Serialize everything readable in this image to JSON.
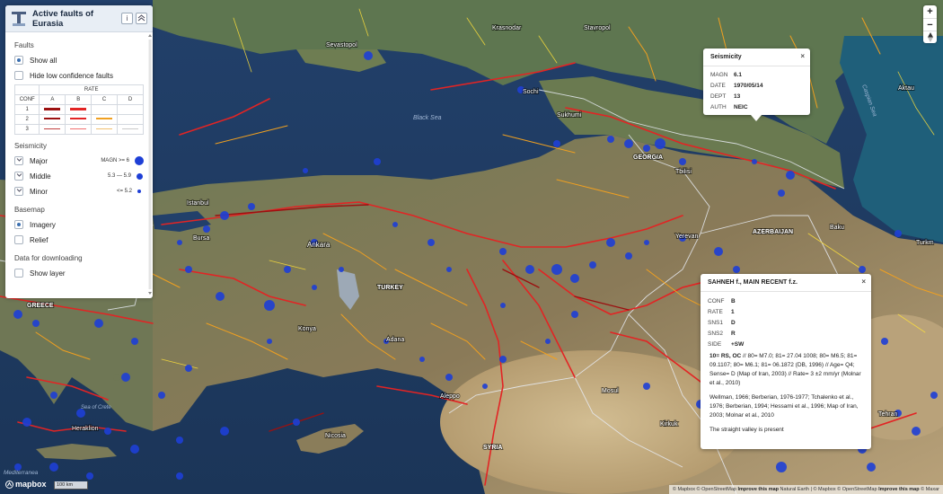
{
  "panel": {
    "title": "Active faults of Eurasia",
    "info_label": "i",
    "collapse_label": "^",
    "faults_heading": "Faults",
    "show_all": "Show all",
    "hide_low": "Hide low confidence faults",
    "rate_header": "RATE",
    "conf_header": "CONF",
    "rate_cols": [
      "A",
      "B",
      "C",
      "D"
    ],
    "conf_rows": [
      "1",
      "2",
      "3"
    ],
    "seismicity_heading": "Seismicity",
    "major": "Major",
    "major_range": "MAGN >= 6",
    "middle": "Middle",
    "middle_range": "5.3 — 5.9",
    "minor": "Minor",
    "minor_range": "<= 5.2",
    "basemap_heading": "Basemap",
    "imagery": "Imagery",
    "relief": "Relief",
    "download_heading": "Data for downloading",
    "show_layer": "Show layer"
  },
  "colors": {
    "dark_red": "#9b1010",
    "red": "#e22424",
    "orange": "#f0a020",
    "light": "#c8c8c8",
    "quake": "#1e3fd6"
  },
  "seismicity_popup": {
    "title": "Seismicity",
    "close": "×",
    "rows": [
      {
        "key": "MAGN",
        "val": "6.1"
      },
      {
        "key": "DATE",
        "val": "1970/05/14"
      },
      {
        "key": "DEPT",
        "val": "13"
      },
      {
        "key": "AUTH",
        "val": "NEIC"
      }
    ]
  },
  "fault_popup": {
    "title": "SAHNEH f., MAIN RECENT f.z.",
    "close": "×",
    "rows": [
      {
        "key": "CONF",
        "val": "B"
      },
      {
        "key": "RATE",
        "val": "1"
      },
      {
        "key": "SNS1",
        "val": "D"
      },
      {
        "key": "SNS2",
        "val": "R"
      },
      {
        "key": "SIDE",
        "val": "+SW"
      }
    ],
    "desc_bold": "10= RS, OC",
    "desc": " // 80= M7.0; 81= 27.04 1008; 80= M6.5; 81= 09.1107; 80= M6.1; 81= 06.1872 (DB, 1996) // Age= Q4; Sense= D (Map of Iran, 2003) // Rate= 3 ±2 mm/yr (Molnar et al., 2010)",
    "refs": "Wellman, 1966; Berberian, 1976-1977; Tchalenko et al., 1976; Berberian, 1994; Hessami et al., 1996; Map of Iran, 2003; Molnar et al., 2010",
    "note": "The straight valley is present"
  },
  "map_labels": {
    "black_sea": "Black Sea",
    "caspian": "Caspian Sea",
    "med": "Mediterranea",
    "sea_of_crete": "Sea of Crete",
    "krasnodar": "Krasnodar",
    "stavropol": "Stavropol",
    "sevastopol": "Sevastopol",
    "sochi": "Sochi",
    "sukhumi": "Sukhumi",
    "georgia": "GEORGIA",
    "tbilisi": "Tbilisi",
    "azerbaijan": "AZERBAIJAN",
    "baku": "Baku",
    "yerevan": "Yerevan",
    "istanbul": "Istanbul",
    "bursa": "Bursa",
    "ankara": "Ankara",
    "turkey": "TURKEY",
    "greece": "GREECE",
    "konya": "Konya",
    "adana": "Adana",
    "nicosia": "Nicosia",
    "heraklion": "Heraklion",
    "aleppo": "Aleppo",
    "mosul": "Mosul",
    "kirkuk": "Kirkuk",
    "syria": "SYRIA",
    "aktau": "Aktau",
    "turkmen": "Turkm",
    "tehran": "Tehran"
  },
  "zoom": {
    "in": "+",
    "out": "−"
  },
  "logo_text": "mapbox",
  "scale_text": "100 km",
  "attribution": {
    "a1": "© Mapbox © OpenStreetMap ",
    "improve1": "Improve this map",
    "a2": " Natural Earth | © Mapbox © OpenStreetMap ",
    "improve2": "Improve this map",
    "a3": " © Maxar"
  }
}
